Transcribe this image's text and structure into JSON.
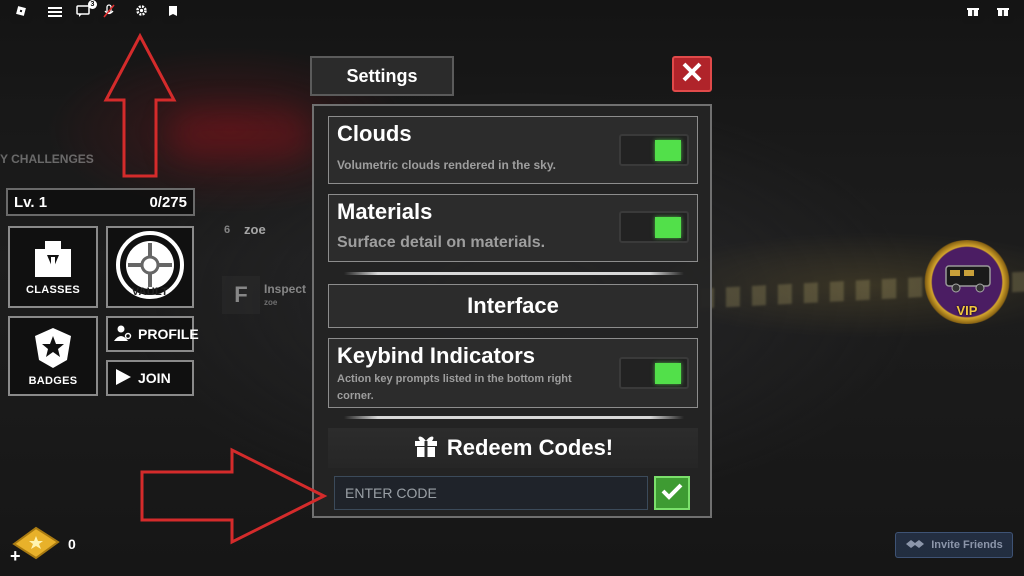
{
  "topbar": {
    "notification_count": "3"
  },
  "hud": {
    "level_label": "Lv. 1",
    "xp_progress": "0/275",
    "tiles": {
      "classes": "CLASSES",
      "vault": "VAULT",
      "badges": "BADGES"
    },
    "profile_label": "PROFILE",
    "join_label": "JOIN",
    "ticket_count": "0",
    "background_labels": {
      "challenges": "Y CHALLENGES",
      "player_name": "zoe",
      "inspect": "Inspect",
      "inspect_sub": "zoe",
      "f_key": "F",
      "number_6": "6"
    }
  },
  "settings": {
    "tab_label": "Settings",
    "options": [
      {
        "title": "Clouds",
        "description": "Volumetric clouds rendered in the sky.",
        "enabled": true
      },
      {
        "title": "Materials",
        "description": "Surface detail on materials.",
        "enabled": true
      },
      {
        "title": "Keybind Indicators",
        "description": "Action key prompts listed in the bottom right corner.",
        "enabled": true
      }
    ],
    "section_interface": "Interface",
    "redeem": {
      "title": "Redeem Codes!",
      "placeholder": "ENTER CODE"
    }
  },
  "right": {
    "vip_label": "VIP",
    "invite_label": "Invite Friends"
  },
  "colors": {
    "close_red": "#b0242a",
    "toggle_on": "#52e04a",
    "submit_green": "#3e9b32",
    "annotation_red": "#d42b2b",
    "vip_gold": "#d4a52c"
  }
}
